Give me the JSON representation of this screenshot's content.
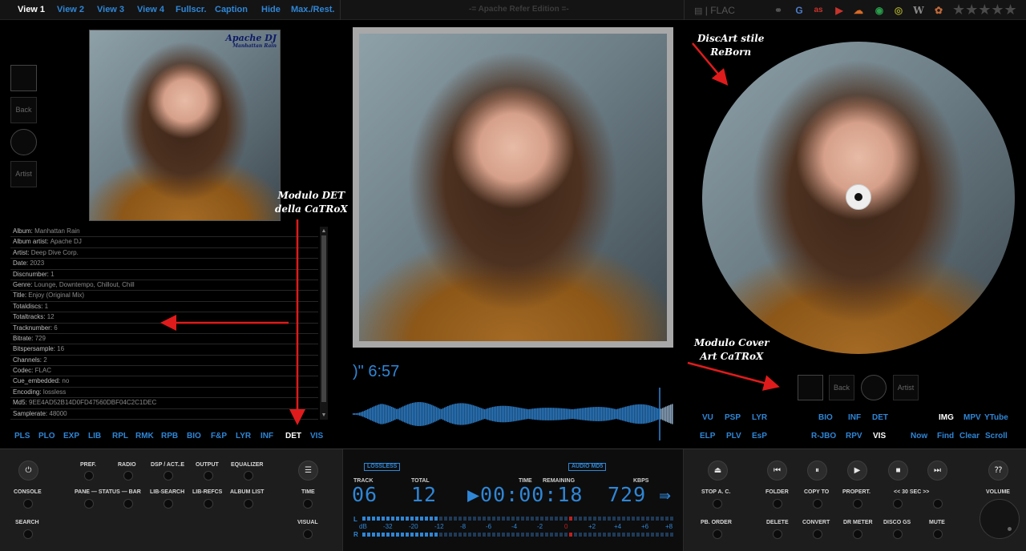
{
  "topbar": {
    "nav": [
      "View 1",
      "View 2",
      "View 3",
      "View 4",
      "Fullscr.",
      "Caption",
      "Hide",
      "Max./Rest."
    ],
    "edition": "-= Apache Refer Edition =-",
    "format": "FLAC",
    "services": [
      "link-icon",
      "google-icon",
      "lastfm-icon",
      "youtube-icon",
      "soundcloud-icon",
      "spotify-icon",
      "discogs-icon",
      "wikipedia-icon",
      "musicbrainz-icon"
    ],
    "rating": "★★★★★"
  },
  "album_art": {
    "title": "Apache DJ",
    "subtitle": "Manhattan Rain"
  },
  "side_thumbs": {
    "back": "Back",
    "artist": "Artist"
  },
  "details": [
    {
      "key": "Album:",
      "value": "Manhattan Rain"
    },
    {
      "key": "Album artist:",
      "value": "Apache DJ"
    },
    {
      "key": "Artist:",
      "value": "Deep Dive Corp."
    },
    {
      "key": "Date:",
      "value": "2023"
    },
    {
      "key": "Discnumber:",
      "value": "1"
    },
    {
      "key": "Genre:",
      "value": "Lounge, Downtempo, Chillout, Chill"
    },
    {
      "key": "Title:",
      "value": "Enjoy (Original Mix)"
    },
    {
      "key": "Totaldiscs:",
      "value": "1"
    },
    {
      "key": "Totaltracks:",
      "value": "12"
    },
    {
      "key": "Tracknumber:",
      "value": "6"
    },
    {
      "key": "Bitrate:",
      "value": "729"
    },
    {
      "key": "Bitspersample:",
      "value": "16"
    },
    {
      "key": "Channels:",
      "value": "2"
    },
    {
      "key": "Codec:",
      "value": "FLAC"
    },
    {
      "key": "Cue_embedded:",
      "value": "no"
    },
    {
      "key": "Encoding:",
      "value": "lossless"
    },
    {
      "key": "Md5:",
      "value": "9EE4AD52B14D0FD47560DBF04C2C1DEC"
    },
    {
      "key": "Samplerate:",
      "value": "48000"
    }
  ],
  "left_tabs": [
    "PLS",
    "PLO",
    "EXP",
    "LIB",
    "RPL",
    "RMK",
    "RPB",
    "BIO",
    "F&P",
    "LYR",
    "INF",
    "DET",
    "VIS"
  ],
  "annotations": {
    "det": "Modulo DET\ndella CaTRoX",
    "discart": "DiscArt stile\nReBorn",
    "cover": "Modulo Cover\nArt CaTRoX"
  },
  "center": {
    "time": ")\" 6:57"
  },
  "right_thumbs": {
    "back": "Back",
    "artist": "Artist"
  },
  "right_tabs_row1": [
    "VU",
    "PSP",
    "LYR",
    "BIO",
    "INF",
    "DET",
    "IMG",
    "MPV",
    "YTube"
  ],
  "right_tabs_row2": [
    "ELP",
    "PLV",
    "EsP",
    "R-JBO",
    "RPV",
    "VIS",
    "Now",
    "Find",
    "Clear",
    "Scroll"
  ],
  "left_controls": {
    "console": "CONSOLE",
    "search": "SEARCH",
    "row1": [
      "PREF.",
      "RADIO",
      "DSP / ACT..E",
      "OUTPUT",
      "EQUALIZER"
    ],
    "row2": [
      "PANE — STATUS — BAR",
      "LIB-SEARCH",
      "LIB-REFCS",
      "ALBUM LIST"
    ],
    "time": "TIME",
    "visual": "VISUAL"
  },
  "lcd": {
    "lossless": "LOSSLESS",
    "audio_md5": "AUDIO MD5",
    "track_label": "TRACK",
    "total_label": "TOTAL",
    "time_label": "TIME",
    "remaining_label": "REMAINING",
    "kbps_label": "KBPS",
    "track": "06",
    "total": "12",
    "time": "▶00:00:18",
    "kbps": "729",
    "meter_scale": [
      "dB",
      "-32",
      "-20",
      "-12",
      "-8",
      "-6",
      "-4",
      "-2",
      "0",
      "+2",
      "+4",
      "+6",
      "+8"
    ],
    "L": "L",
    "R": "R"
  },
  "right_controls": {
    "row1": [
      "STOP A. C.",
      "FOLDER",
      "COPY TO",
      "PROPERT.",
      "<<  30  SEC  >>"
    ],
    "row2": [
      "PB. ORDER",
      "DELETE",
      "CONVERT",
      "DR METER",
      "DISCO GS",
      "MUTE"
    ],
    "volume": "VOLUME"
  },
  "colors": {
    "accent": "#2f86d6",
    "background": "#000000",
    "panel": "#1d1d1d",
    "arrow": "#e01b1b"
  }
}
